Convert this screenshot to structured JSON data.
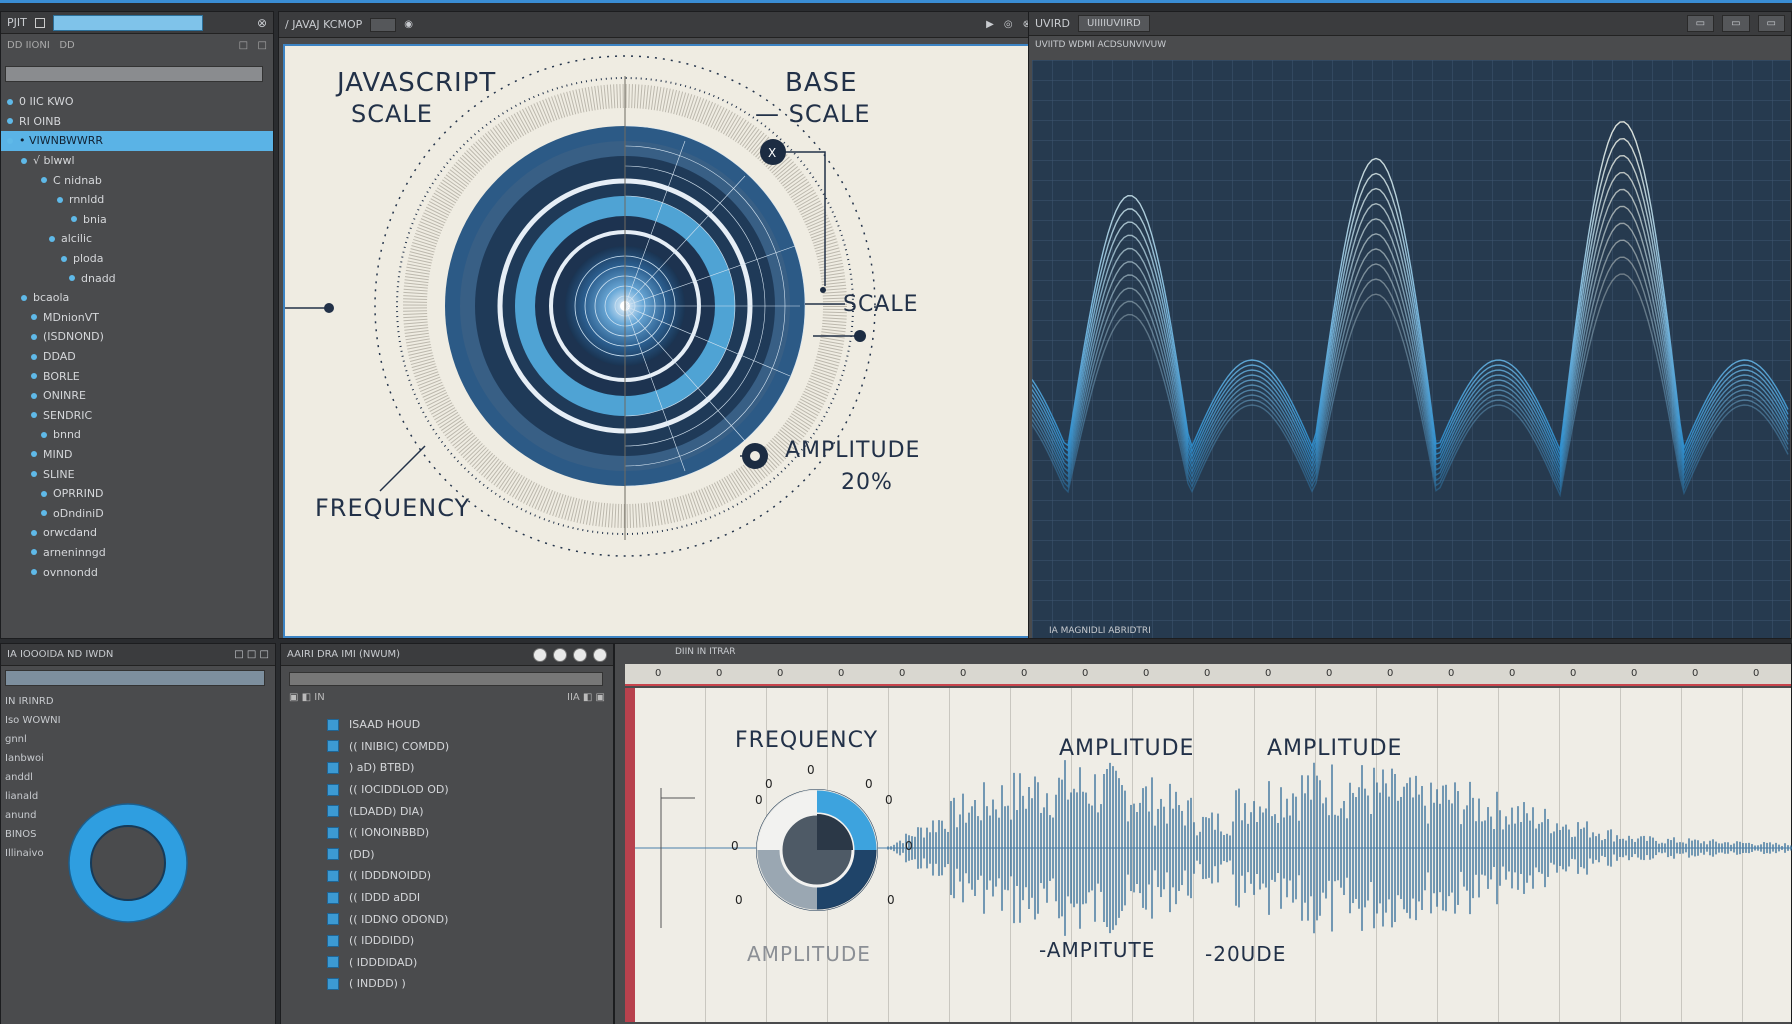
{
  "window": {
    "left_title": "PJIT",
    "center_title": "/ JAVAJ KCMOP",
    "right_title": "UVIRD"
  },
  "left_panel": {
    "items": [
      {
        "label": "0 IIC KWO",
        "selected": false
      },
      {
        "label": "RI OINB",
        "selected": false
      },
      {
        "label": "•  VIWNBWWRR",
        "selected": true
      },
      {
        "label": "√ blwwl",
        "selected": false
      },
      {
        "label": "C nidnab",
        "selected": false
      },
      {
        "label": "rnnldd",
        "selected": false
      },
      {
        "label": "bnia",
        "selected": false
      },
      {
        "label": "alcilic",
        "selected": false
      },
      {
        "label": "ploda",
        "selected": false
      },
      {
        "label": "dnadd",
        "selected": false
      },
      {
        "label": "bcaola",
        "selected": false
      },
      {
        "label": "MDnionVT",
        "selected": false
      },
      {
        "label": "(ISDNOND)",
        "selected": false
      },
      {
        "label": "DDAD",
        "selected": false
      },
      {
        "label": "BORLE",
        "selected": false
      },
      {
        "label": "ONINRE",
        "selected": false
      },
      {
        "label": "SENDRIC",
        "selected": false
      },
      {
        "label": "bnnd",
        "selected": false
      },
      {
        "label": "MIND",
        "selected": false
      },
      {
        "label": "SLINE",
        "selected": false
      },
      {
        "label": "OPRRIND",
        "selected": false
      },
      {
        "label": "oDndiniD",
        "selected": false
      },
      {
        "label": "orwcdand",
        "selected": false
      },
      {
        "label": "arneninngd",
        "selected": false
      },
      {
        "label": "ovnnondd",
        "selected": false
      }
    ]
  },
  "center_panel": {
    "labels": {
      "js_scale": "JAVASCRIPT",
      "js_scale2": "SCALE",
      "base": "BASE",
      "base_scale": "SCALE",
      "scale": "SCALE",
      "frequency": "FREQUENCY",
      "amplitude": "AMPLITUDE",
      "percent": "20%"
    }
  },
  "right_panel": {
    "header": "UIIIIUVIIRD",
    "subheader": "UVIITD WDMI ACDSUNVIVUW",
    "footer": "IA MAGNIDLI ABRIDTRI"
  },
  "bottom_left": {
    "title": "IA IOOOIDA ND IWDN",
    "rows": [
      "IN IRINRD",
      "Iso WOWNI",
      "gnnl",
      "Ianbwoi",
      "anddl",
      "lianald",
      "anund",
      "BINOS",
      "Illinaivo"
    ]
  },
  "bottom_middle": {
    "title": "AAIRI DRA IMI (NWUM)",
    "rows": [
      "ISAAD HOUD",
      "(( INIBIC) COMDD)",
      ") aD) BTBD)",
      "(( IOCIDDLOD OD)",
      "(LDADD) DIA)",
      "(( IONOINBBD)",
      "(DD)",
      "(( IDDDNOIDD)",
      "(( IDDD aDDI",
      "(( IDDNO ODOND)",
      "(( IDDDIDD)",
      "( IDDDIDAD)",
      "( INDDD) )"
    ]
  },
  "bottom_right": {
    "title": "DIIN IN ITRAR",
    "labels": {
      "frequency": "FREQUENCY",
      "amplitude1": "AMPLITUDE",
      "amplitude2": "AMPLITUDE",
      "knob_label": "AMPLITUDE",
      "neg_amp": "-AMPITUTE",
      "neg_amp2": "-20UDE"
    }
  }
}
